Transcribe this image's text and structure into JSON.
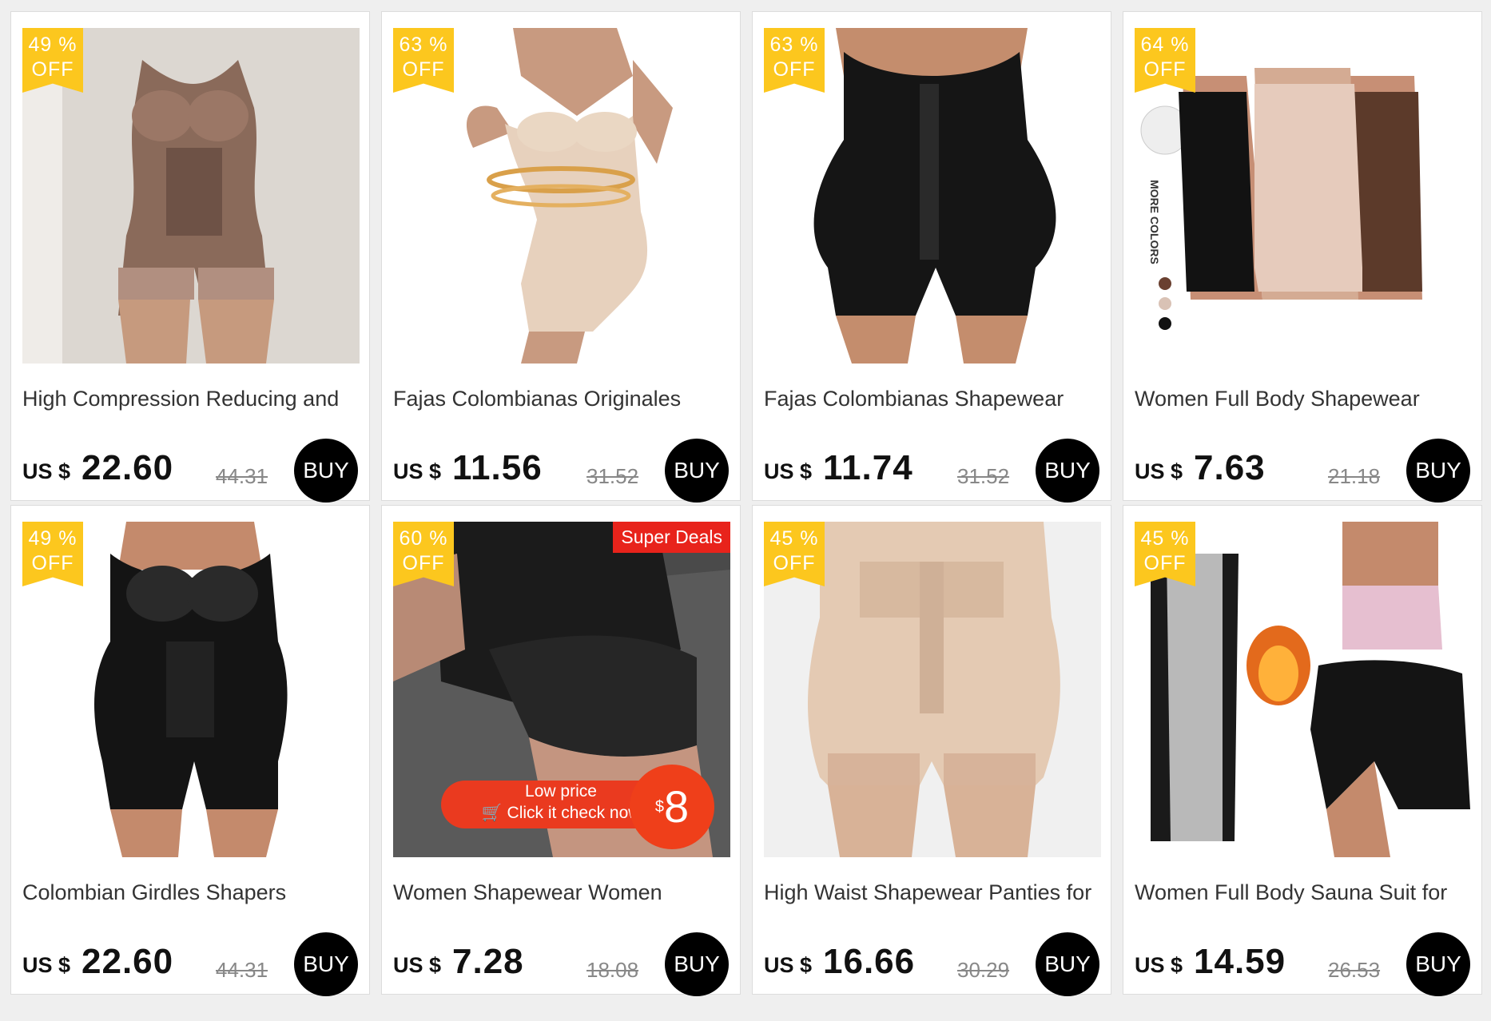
{
  "badge_suffix": "OFF",
  "currency_label": "US $",
  "buy_label": "BUY",
  "colors": {
    "badge": "#fcc71e",
    "buy_button": "#000000",
    "background": "#efefef",
    "super_deals": "#e8231b"
  },
  "products": [
    {
      "discount": "49 %",
      "title": "High Compression Reducing and",
      "price": "22.60",
      "original_price": "44.31"
    },
    {
      "discount": "63 %",
      "title": "Fajas Colombianas Originales",
      "price": "11.56",
      "original_price": "31.52"
    },
    {
      "discount": "63 %",
      "title": "Fajas Colombianas Shapewear",
      "price": "11.74",
      "original_price": "31.52"
    },
    {
      "discount": "64 %",
      "title": "Women Full Body Shapewear",
      "price": "7.63",
      "original_price": "21.18",
      "image_text": "MORE COLORS"
    },
    {
      "discount": "49 %",
      "title": "Colombian Girdles Shapers",
      "price": "22.60",
      "original_price": "44.31"
    },
    {
      "discount": "60 %",
      "title": "Women Shapewear Women",
      "price": "7.28",
      "original_price": "18.08",
      "image_text": {
        "super_deals": "Super Deals",
        "low_price": "Low price",
        "check": "Click it check now",
        "currency": "$",
        "amount": "8"
      }
    },
    {
      "discount": "45 %",
      "title": "High Waist Shapewear Panties for",
      "price": "16.66",
      "original_price": "30.29"
    },
    {
      "discount": "45 %",
      "title": "Women Full Body Sauna Suit for",
      "price": "14.59",
      "original_price": "26.53"
    }
  ]
}
